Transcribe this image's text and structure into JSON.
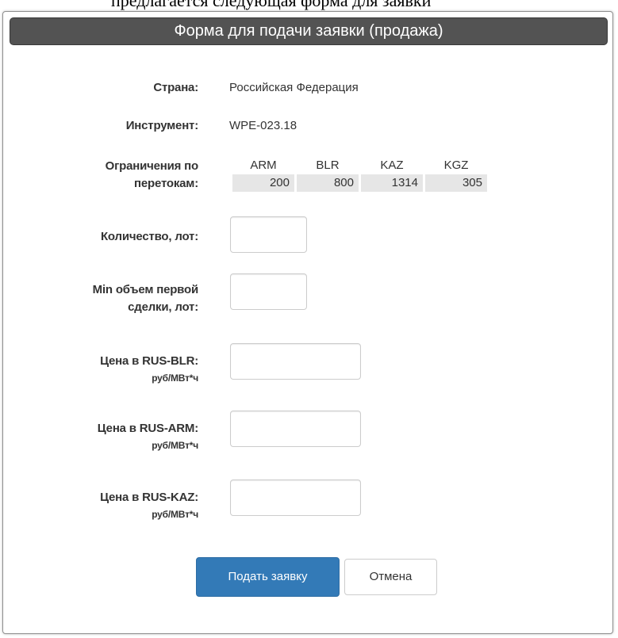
{
  "page": {
    "top_text": "предлагается следующая форма для заявки"
  },
  "dialog": {
    "title": "Форма для подачи заявки (продажа)"
  },
  "form": {
    "country": {
      "label": "Страна:",
      "value": "Российская Федерация"
    },
    "instrument": {
      "label": "Инструмент:",
      "value": "WPE-023.18"
    },
    "flow_limits": {
      "label_line1": "Ограничения по",
      "label_line2": "перетокам:",
      "columns": [
        "ARM",
        "BLR",
        "KAZ",
        "KGZ"
      ],
      "values": [
        "200",
        "800",
        "1314",
        "305"
      ]
    },
    "quantity": {
      "label": "Количество, лот:",
      "value": ""
    },
    "min_first_deal": {
      "label_line1": "Min объем первой",
      "label_line2": "сделки, лот:",
      "value": ""
    },
    "price_blr": {
      "label": "Цена в RUS-BLR:",
      "unit": "руб/МВт*ч",
      "value": ""
    },
    "price_arm": {
      "label": "Цена в RUS-ARM:",
      "unit": "руб/МВт*ч",
      "value": ""
    },
    "price_kaz": {
      "label": "Цена в RUS-KAZ:",
      "unit": "руб/МВт*ч",
      "value": ""
    }
  },
  "actions": {
    "submit_label": "Подать заявку",
    "cancel_label": "Отмена"
  },
  "colors": {
    "titlebar": "#535353",
    "primary": "#337ab7",
    "cell_bg": "#e6e6e6"
  }
}
